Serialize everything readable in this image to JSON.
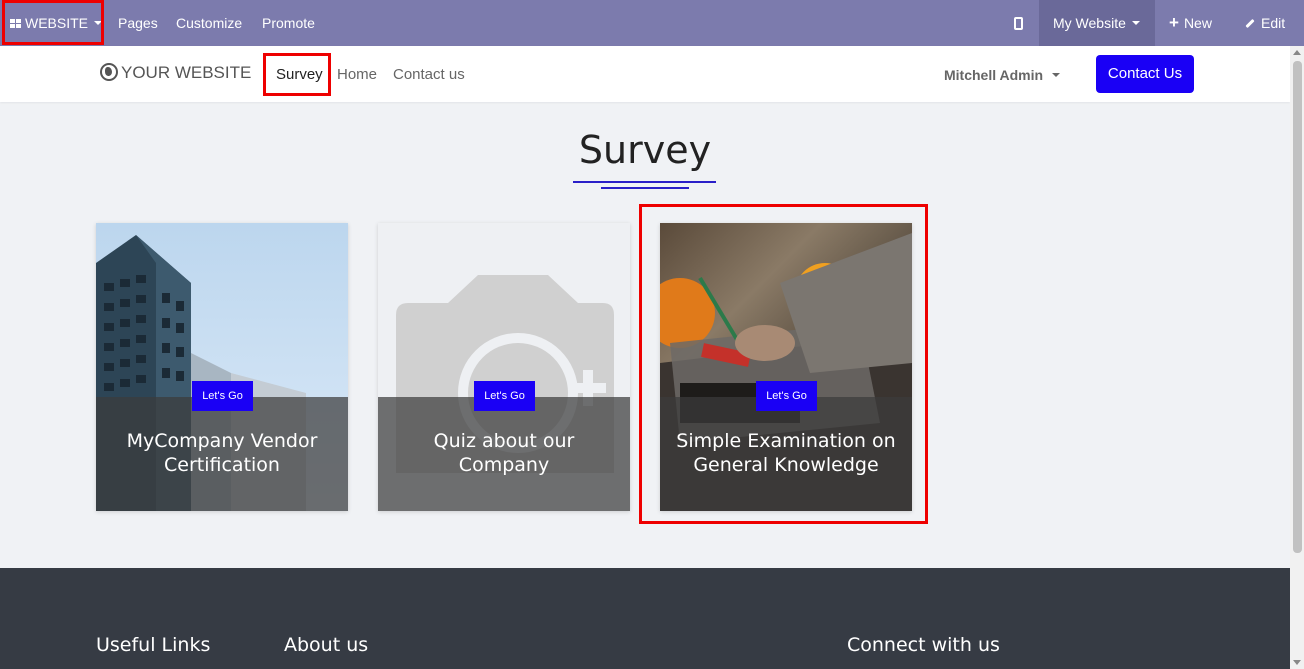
{
  "admin_bar": {
    "website_label": "WEBSITE",
    "pages_label": "Pages",
    "customize_label": "Customize",
    "promote_label": "Promote",
    "my_website_label": "My Website",
    "new_label": "New",
    "edit_label": "Edit",
    "background_color": "#7c7bad"
  },
  "header": {
    "logo_text": "YOUR WEBSITE",
    "nav": [
      "Survey",
      "Home",
      "Contact us"
    ],
    "user_name": "Mitchell Admin",
    "contact_button": "Contact Us",
    "accent_color": "#1a00f5"
  },
  "main": {
    "title": "Survey",
    "cards": [
      {
        "button": "Let's Go",
        "title": "MyCompany Vendor Certification",
        "image": "building-photo"
      },
      {
        "button": "Let's Go",
        "title": "Quiz about our Company",
        "image": "camera-placeholder-icon"
      },
      {
        "button": "Let's Go",
        "title": "Simple Examination on General Knowledge",
        "image": "engineer-desk-photo"
      }
    ]
  },
  "footer": {
    "headings": [
      "Useful Links",
      "About us",
      "Connect with us"
    ],
    "background_color": "#363b44"
  }
}
